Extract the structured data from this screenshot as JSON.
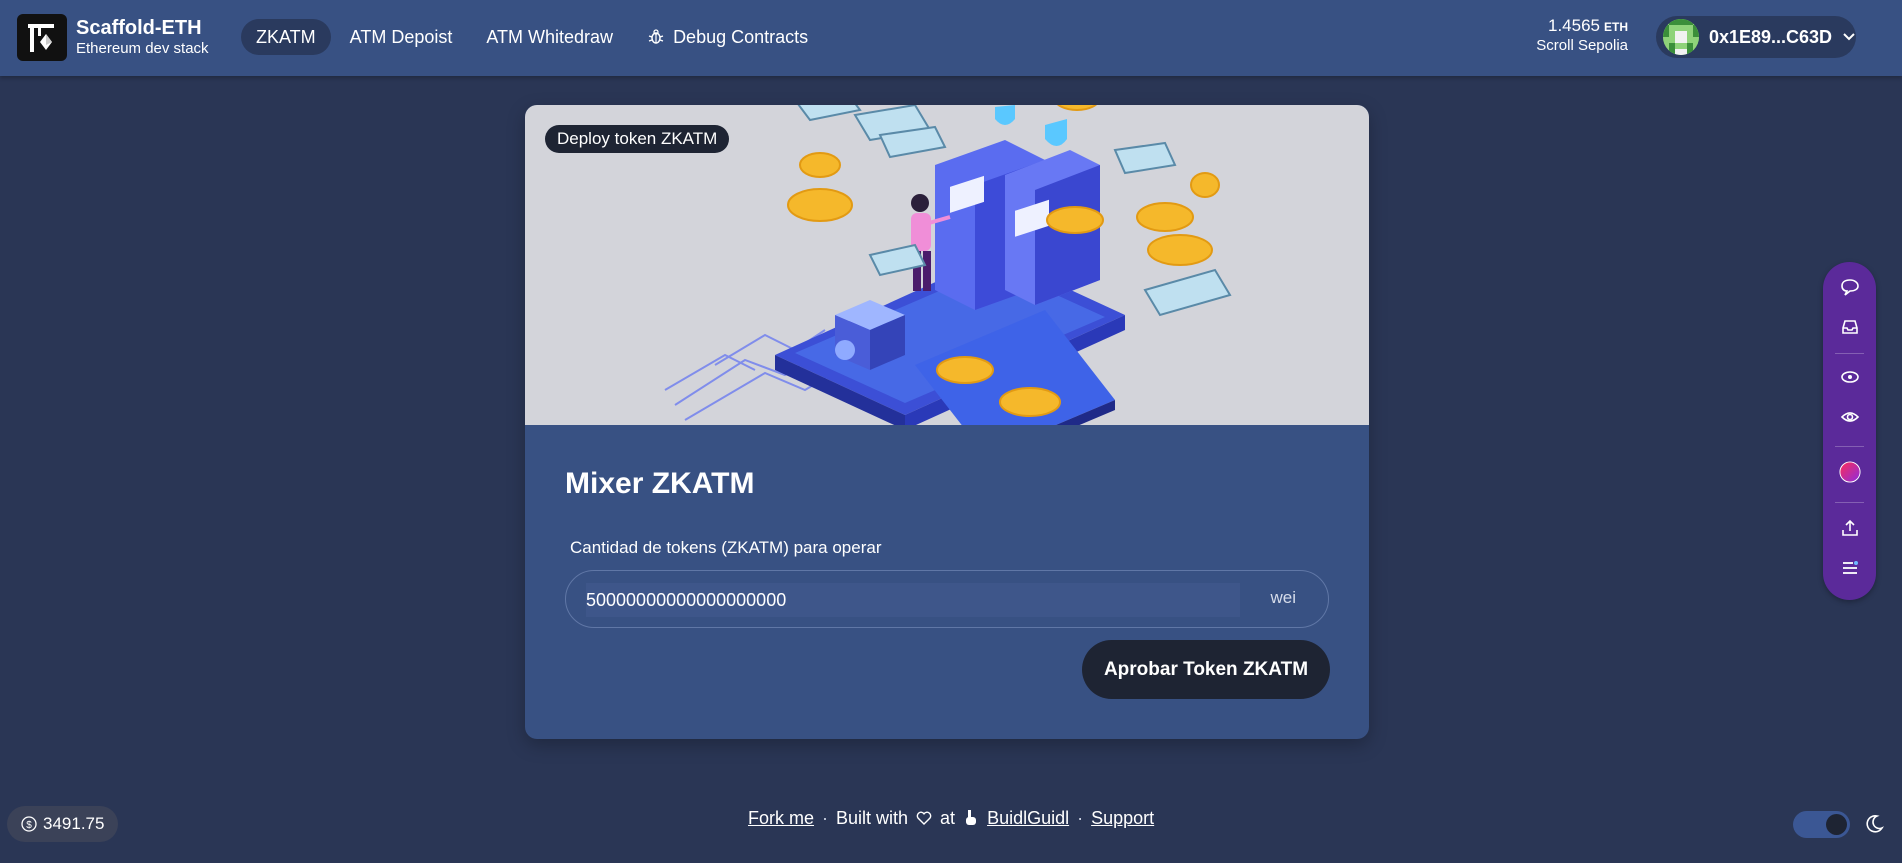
{
  "brand": {
    "title": "Scaffold-ETH",
    "subtitle": "Ethereum dev stack"
  },
  "nav": {
    "items": [
      {
        "label": "ZKATM",
        "active": true
      },
      {
        "label": "ATM Depoist"
      },
      {
        "label": "ATM Whitedraw"
      },
      {
        "label": "Debug Contracts",
        "icon": "bug-icon"
      }
    ]
  },
  "wallet": {
    "balance": "1.4565",
    "currency": "ETH",
    "network": "Scroll Sepolia",
    "address": "0x1E89...C63D"
  },
  "card": {
    "badge": "Deploy token ZKATM",
    "title": "Mixer ZKATM",
    "field_label": "Cantidad de tokens (ZKATM) para operar",
    "input_value": "50000000000000000000",
    "unit": "wei",
    "button": "Aprobar Token ZKATM"
  },
  "side_panel": {
    "icons": [
      "chat-icon",
      "inbox-icon",
      "eye-outline-icon",
      "eye-icon",
      "profile-gradient-icon",
      "upload-icon",
      "menu-icon"
    ]
  },
  "footer": {
    "price": "3491.75",
    "fork": "Fork me",
    "built_with": "Built with",
    "at": "at",
    "buidlguidl": "BuidlGuidl",
    "support": "Support"
  },
  "colors": {
    "background": "#2a3655",
    "header": "#385183",
    "card": "#385183",
    "accent_dark": "#1e2433",
    "side_panel": "#5b2a9a"
  }
}
